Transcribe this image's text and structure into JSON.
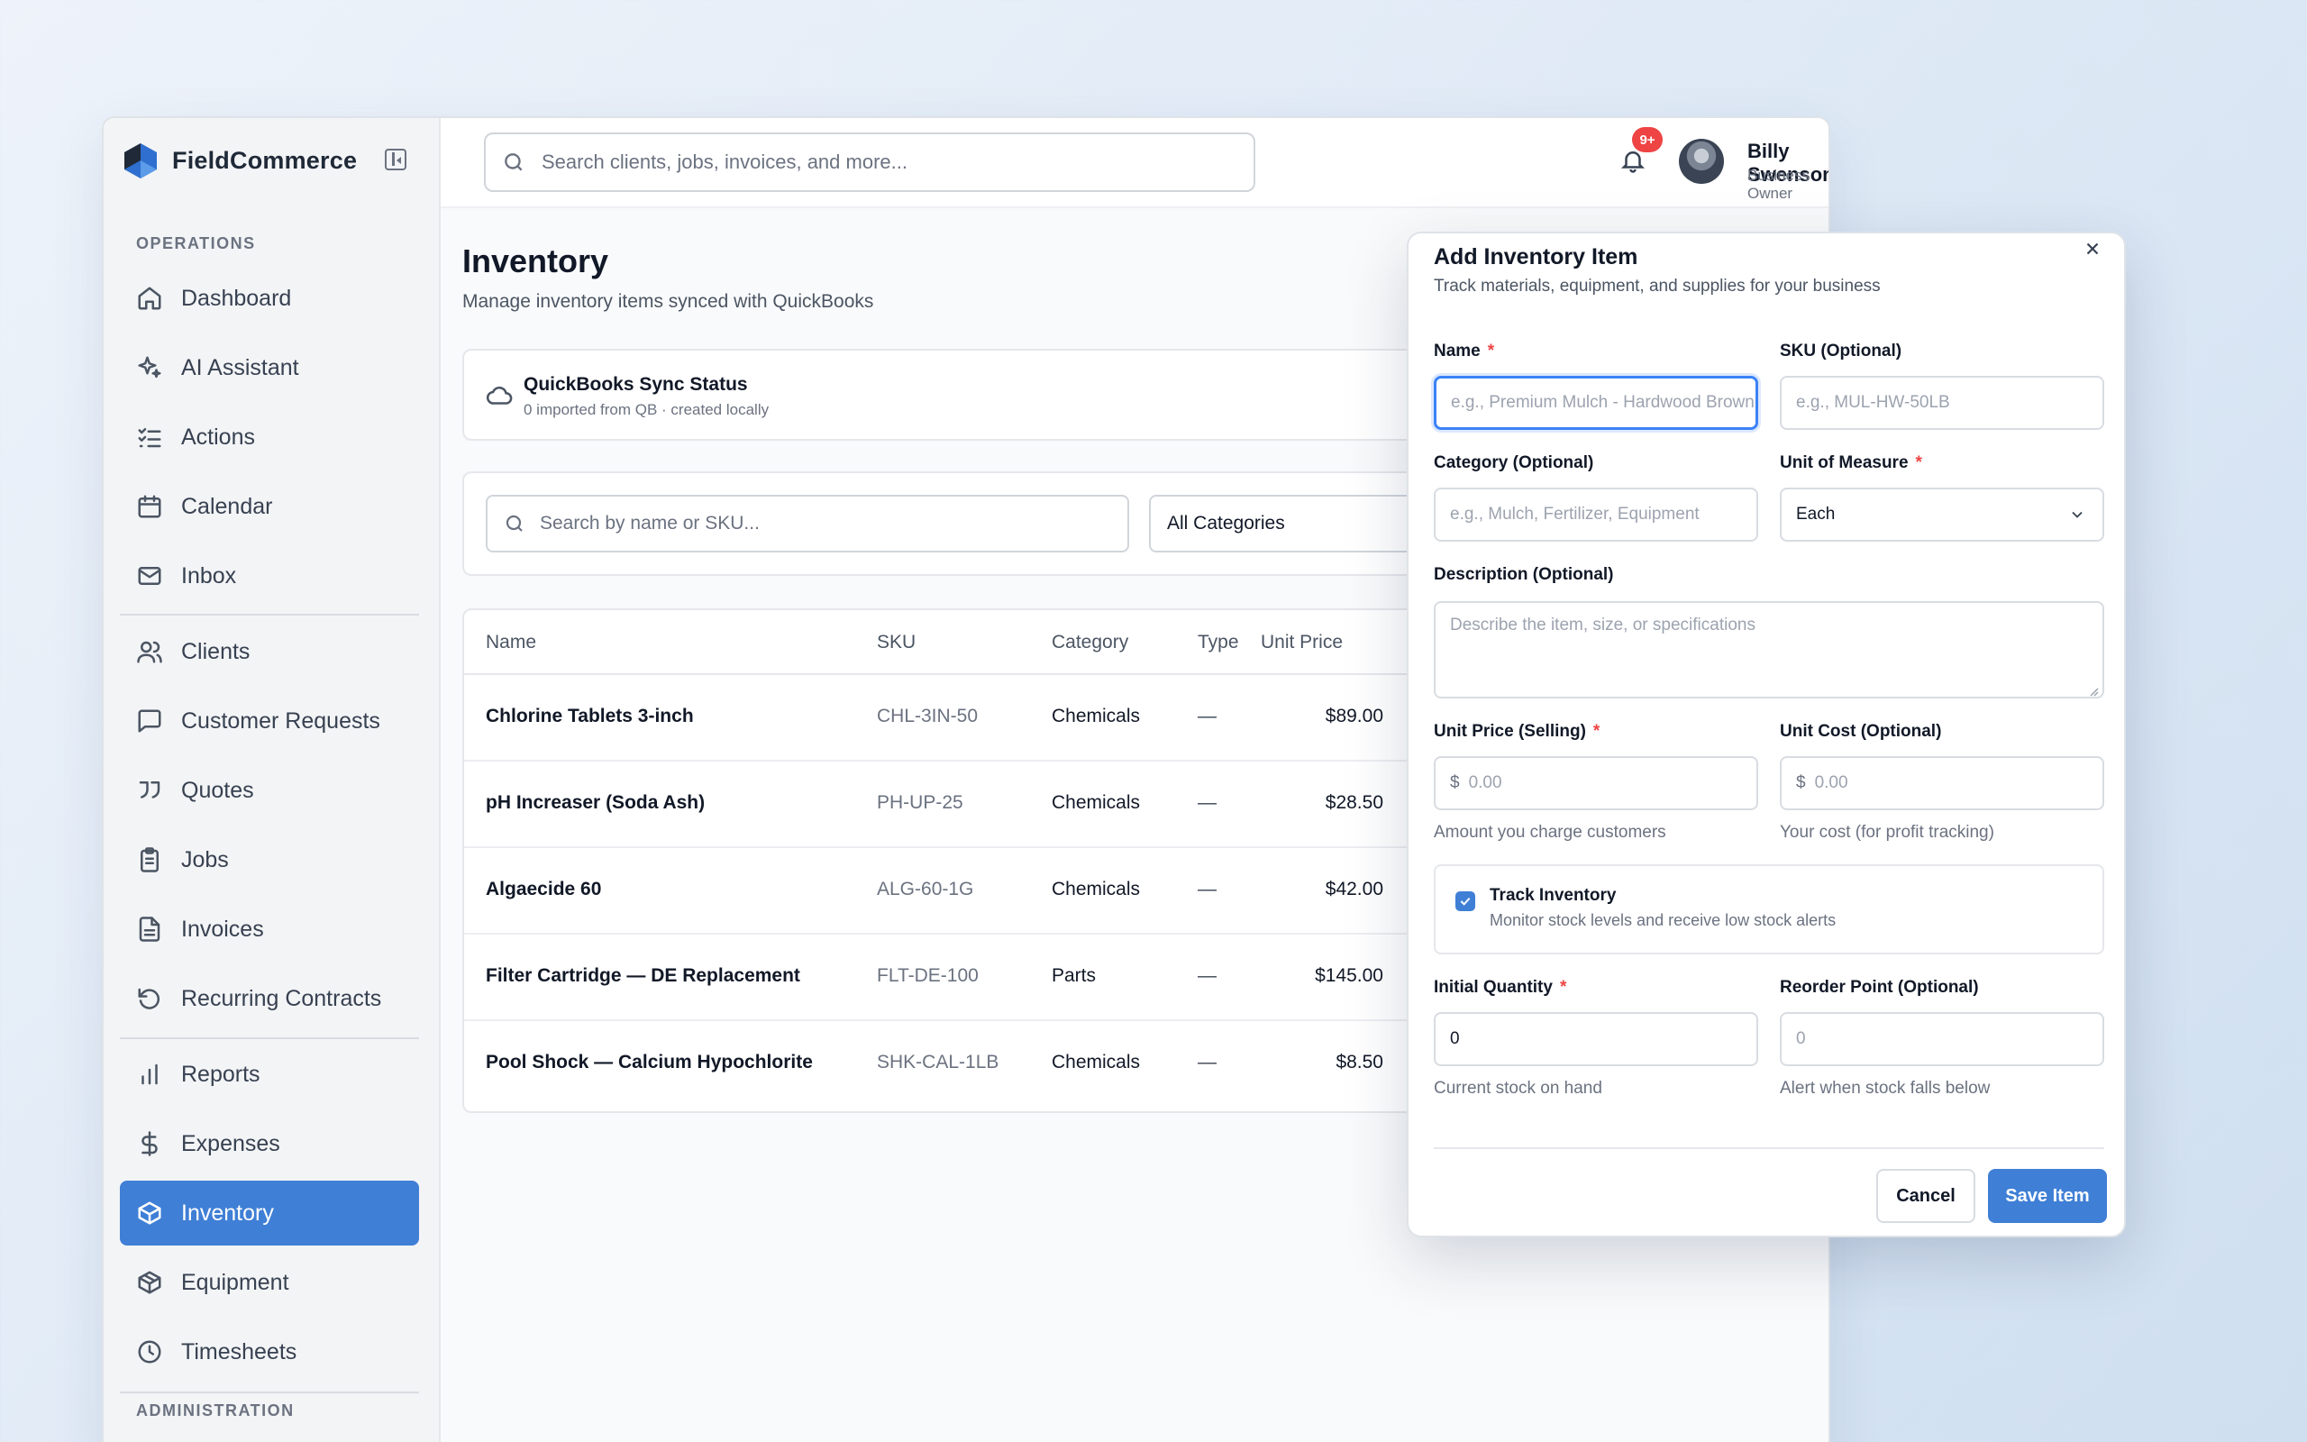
{
  "app": {
    "name": "FieldCommerce"
  },
  "sidebar": {
    "section_operations": "OPERATIONS",
    "section_administration": "ADMINISTRATION",
    "items": [
      {
        "label": "Dashboard",
        "icon": "home-icon"
      },
      {
        "label": "AI Assistant",
        "icon": "sparkles-icon"
      },
      {
        "label": "Actions",
        "icon": "list-checks-icon"
      },
      {
        "label": "Calendar",
        "icon": "calendar-icon"
      },
      {
        "label": "Inbox",
        "icon": "mail-icon"
      },
      {
        "label": "Clients",
        "icon": "users-icon"
      },
      {
        "label": "Customer Requests",
        "icon": "message-square-icon"
      },
      {
        "label": "Quotes",
        "icon": "quote-icon"
      },
      {
        "label": "Jobs",
        "icon": "clipboard-icon"
      },
      {
        "label": "Invoices",
        "icon": "file-text-icon"
      },
      {
        "label": "Recurring Contracts",
        "icon": "rotate-ccw-icon"
      },
      {
        "label": "Reports",
        "icon": "bar-chart-icon"
      },
      {
        "label": "Expenses",
        "icon": "dollar-sign-icon"
      },
      {
        "label": "Inventory",
        "icon": "box-icon",
        "active": true
      },
      {
        "label": "Equipment",
        "icon": "package-icon"
      },
      {
        "label": "Timesheets",
        "icon": "clock-icon"
      }
    ]
  },
  "topbar": {
    "search_placeholder": "Search clients, jobs, invoices, and more...",
    "notification_badge": "9+",
    "user_name": "Billy Swenson",
    "user_role": "Business Owner"
  },
  "page": {
    "title": "Inventory",
    "subtitle": "Manage inventory items synced with QuickBooks",
    "sync_title": "QuickBooks Sync Status",
    "sync_sub": "0 imported from QB · created locally",
    "search_placeholder": "Search by name or SKU...",
    "category_filter": "All Categories"
  },
  "table": {
    "headers": [
      "Name",
      "SKU",
      "Category",
      "Type",
      "Unit Price"
    ],
    "rows": [
      {
        "name": "Chlorine Tablets 3-inch",
        "sku": "CHL-3IN-50",
        "category": "Chemicals",
        "type": "—",
        "price": "$89.00"
      },
      {
        "name": "pH Increaser (Soda Ash)",
        "sku": "PH-UP-25",
        "category": "Chemicals",
        "type": "—",
        "price": "$28.50"
      },
      {
        "name": "Algaecide 60",
        "sku": "ALG-60-1G",
        "category": "Chemicals",
        "type": "—",
        "price": "$42.00"
      },
      {
        "name": "Filter Cartridge — DE Replacement",
        "sku": "FLT-DE-100",
        "category": "Parts",
        "type": "—",
        "price": "$145.00"
      },
      {
        "name": "Pool Shock — Calcium Hypochlorite",
        "sku": "SHK-CAL-1LB",
        "category": "Chemicals",
        "type": "—",
        "price": "$8.50"
      }
    ]
  },
  "modal": {
    "title": "Add Inventory Item",
    "subtitle": "Track materials, equipment, and supplies for your business",
    "name_label": "Name",
    "name_placeholder": "e.g., Premium Mulch - Hardwood Brown",
    "sku_label": "SKU (Optional)",
    "sku_placeholder": "e.g., MUL-HW-50LB",
    "category_label": "Category (Optional)",
    "category_placeholder": "e.g., Mulch, Fertilizer, Equipment",
    "uom_label": "Unit of Measure",
    "uom_value": "Each",
    "description_label": "Description (Optional)",
    "description_placeholder": "Describe the item, size, or specifications",
    "unit_price_label": "Unit Price (Selling)",
    "unit_price_placeholder": "0.00",
    "unit_price_hint": "Amount you charge customers",
    "unit_cost_label": "Unit Cost (Optional)",
    "unit_cost_placeholder": "0.00",
    "unit_cost_hint": "Your cost (for profit tracking)",
    "currency_symbol": "$",
    "track_title": "Track Inventory",
    "track_sub": "Monitor stock levels and receive low stock alerts",
    "track_checked": true,
    "initial_qty_label": "Initial Quantity",
    "initial_qty_value": "0",
    "initial_qty_hint": "Current stock on hand",
    "reorder_label": "Reorder Point (Optional)",
    "reorder_placeholder": "0",
    "reorder_hint": "Alert when stock falls below",
    "required_mark": "*",
    "cancel_label": "Cancel",
    "save_label": "Save Item"
  },
  "colors": {
    "accent": "#3f7fd6",
    "required": "#ef4444",
    "badge": "#ef4444"
  }
}
